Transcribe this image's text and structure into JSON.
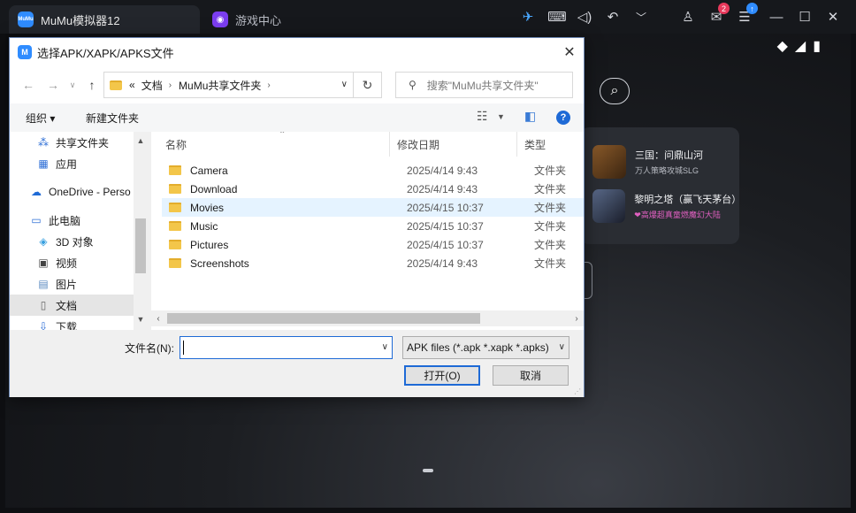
{
  "emulator": {
    "tabs": [
      {
        "label": "MuMu模拟器12",
        "logo": "MuMu"
      },
      {
        "label": "游戏中心"
      }
    ],
    "badges": {
      "messages": "2",
      "menu": "↑"
    }
  },
  "android": {
    "recommendations": [
      {
        "title": "三国：问鼎山河",
        "subtitle": "万人策略攻城SLG"
      },
      {
        "title": "黎明之塔（赢飞天茅台）",
        "subtitle": "❤高爆超真童燃魔幻大陆"
      }
    ]
  },
  "dialog": {
    "title": "选择APK/XAPK/APKS文件",
    "close_glyph": "✕",
    "address": {
      "prefix": "«",
      "crumbs": [
        "文档",
        "MuMu共享文件夹"
      ]
    },
    "search_placeholder": "搜索\"MuMu共享文件夹\"",
    "toolbar": {
      "organize": "组织 ▾",
      "new_folder": "新建文件夹"
    },
    "nav_items": [
      {
        "label": "共享文件夹",
        "icon": "share-icon"
      },
      {
        "label": "应用",
        "icon": "apps-icon"
      },
      {
        "label": "OneDrive - Perso",
        "icon": "cloud-icon"
      },
      {
        "label": "此电脑",
        "icon": "computer-icon"
      },
      {
        "label": "3D 对象",
        "icon": "cube-icon"
      },
      {
        "label": "视频",
        "icon": "video-icon"
      },
      {
        "label": "图片",
        "icon": "picture-icon"
      },
      {
        "label": "文档",
        "icon": "document-icon"
      },
      {
        "label": "下载",
        "icon": "download-icon"
      }
    ],
    "columns": {
      "name": "名称",
      "date": "修改日期",
      "type": "类型"
    },
    "files": [
      {
        "name": "Camera",
        "date": "2025/4/14 9:43",
        "type": "文件夹"
      },
      {
        "name": "Download",
        "date": "2025/4/14 9:43",
        "type": "文件夹"
      },
      {
        "name": "Movies",
        "date": "2025/4/15 10:37",
        "type": "文件夹"
      },
      {
        "name": "Music",
        "date": "2025/4/15 10:37",
        "type": "文件夹"
      },
      {
        "name": "Pictures",
        "date": "2025/4/15 10:37",
        "type": "文件夹"
      },
      {
        "name": "Screenshots",
        "date": "2025/4/14 9:43",
        "type": "文件夹"
      }
    ],
    "filename_label": "文件名(N):",
    "filename_value": "",
    "file_type": "APK files (*.apk *.xapk *.apks)",
    "open_button": "打开(O)",
    "cancel_button": "取消"
  }
}
